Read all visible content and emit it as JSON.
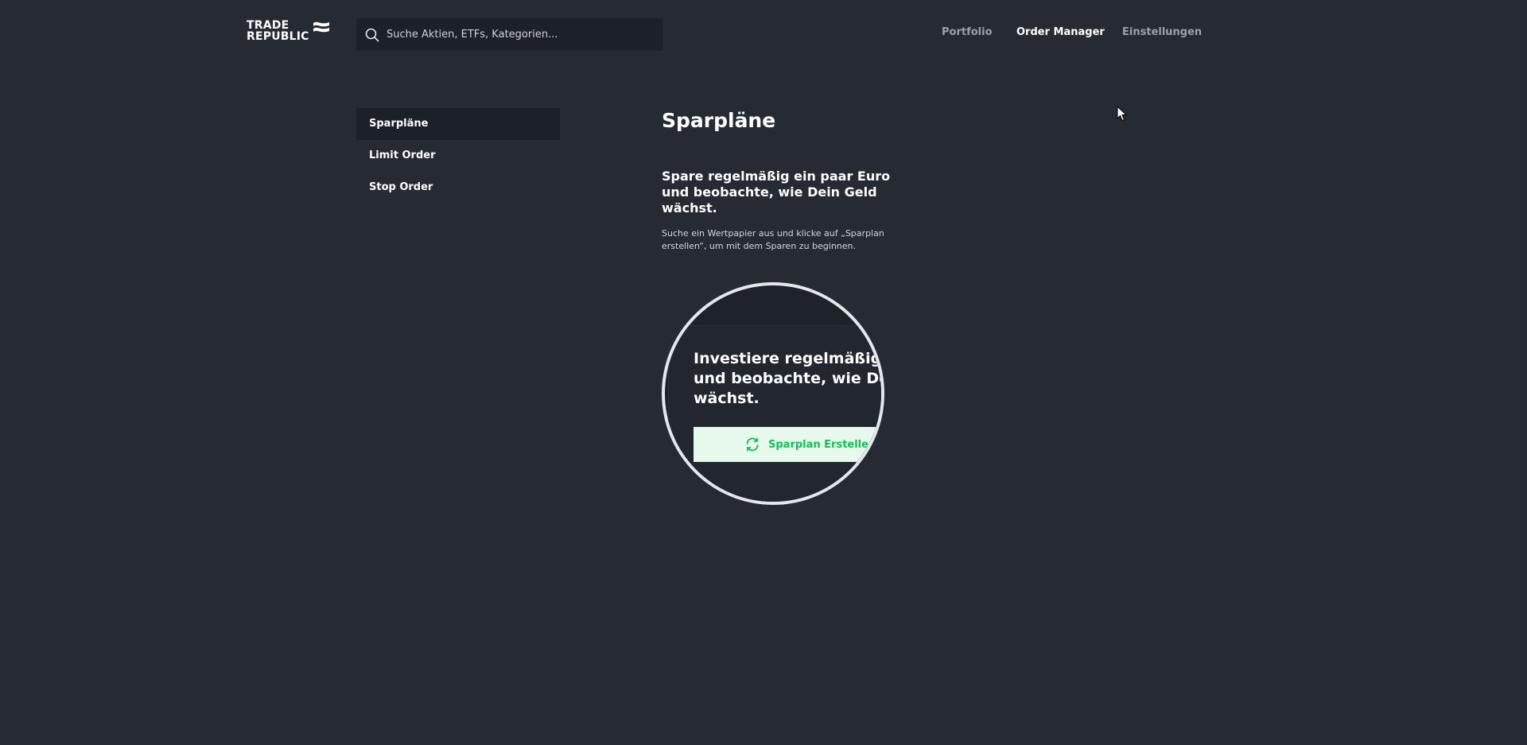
{
  "header": {
    "logo": {
      "line1": "TRADE",
      "line2": "REPUBLIC"
    },
    "search": {
      "placeholder": "Suche Aktien, ETFs, Kategorien...",
      "value": "",
      "icon": "search-icon"
    },
    "nav": [
      {
        "label": "Portfolio",
        "active": false
      },
      {
        "label": "Order Manager",
        "active": true
      },
      {
        "label": "Einstellungen",
        "active": false
      }
    ]
  },
  "sidebar": {
    "items": [
      {
        "label": "Sparpläne",
        "active": true
      },
      {
        "label": "Limit Order",
        "active": false
      },
      {
        "label": "Stop Order",
        "active": false
      }
    ]
  },
  "main": {
    "title": "Sparpläne",
    "subtitle": "Spare regelmäßig ein paar Euro und beobachte, wie Dein Geld wächst.",
    "description": "Suche ein Wertpapier aus und klicke auf „Sparplan erstellen“, um mit dem Sparen zu beginnen.",
    "illustration": {
      "title": "Investiere regelmäßig ein\nund beobachte, wie Dein Ge\nwächst.",
      "button_label": "Sparplan Erstellen",
      "button_icon": "refresh-icon"
    }
  },
  "colors": {
    "background": "#252a33",
    "panel": "#1c2027",
    "nav_inactive": "#9aa1ab",
    "accent_green": "#14c04f",
    "button_bg": "#e6f9ec"
  }
}
